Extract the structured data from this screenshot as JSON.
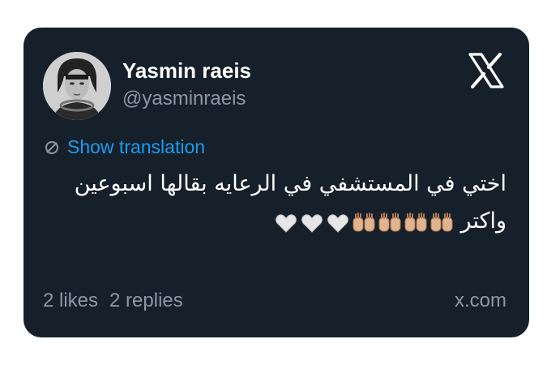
{
  "tweet": {
    "author": {
      "name": "Yasmin raeis",
      "handle": "@yasminraeis"
    },
    "translate_label": "Show translation",
    "text_line1": "اختي في المستشفي في الرعايه بقالها اسبوعين",
    "text_line2": "واكتر",
    "emoji": [
      "palms-up-together-medium-light",
      "palms-up-together-medium-light",
      "palms-up-together-medium-light",
      "palms-up-together-medium-light",
      "white-heart",
      "white-heart",
      "white-heart"
    ],
    "stats": {
      "likes": "2 likes",
      "replies": "2 replies"
    },
    "source": "x.com"
  },
  "colors": {
    "card_bg": "#15202b",
    "accent": "#1d9bf0",
    "muted": "#8b98a5"
  }
}
